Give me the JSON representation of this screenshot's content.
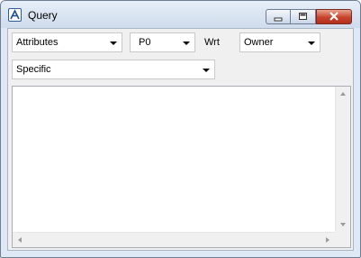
{
  "window": {
    "title": "Query"
  },
  "controls": {
    "attributes_select": {
      "value": "Attributes"
    },
    "p0_select": {
      "value": "P0"
    },
    "wrt_label": "Wrt",
    "owner_select": {
      "value": "Owner"
    },
    "specific_select": {
      "value": "Specific"
    }
  },
  "output": {
    "value": ""
  }
}
